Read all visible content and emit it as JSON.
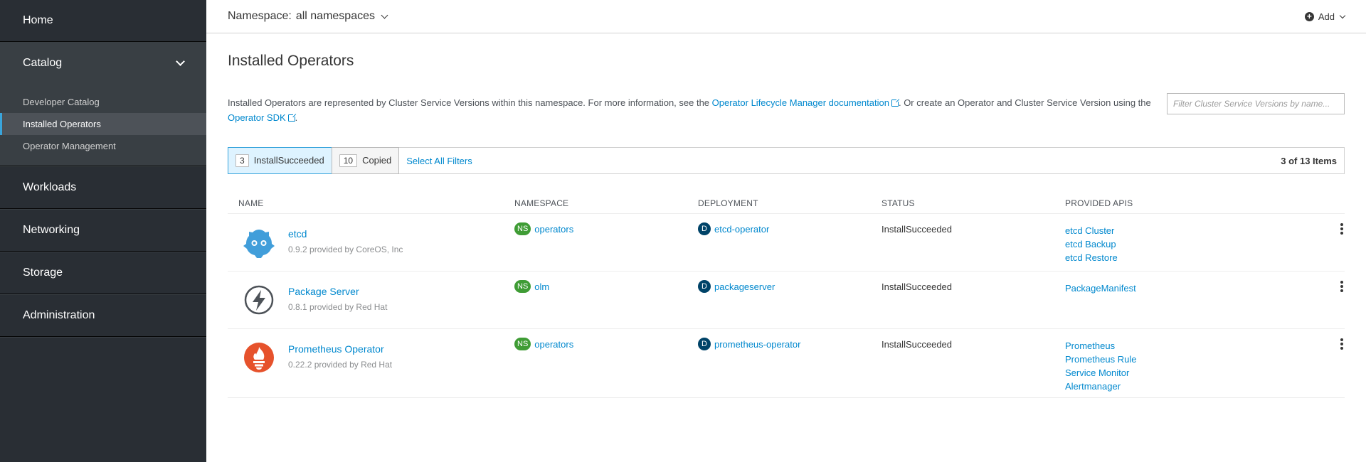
{
  "sidebar": {
    "home": "Home",
    "catalog": "Catalog",
    "catalog_items": [
      "Developer Catalog",
      "Installed Operators",
      "Operator Management"
    ],
    "workloads": "Workloads",
    "networking": "Networking",
    "storage": "Storage",
    "administration": "Administration"
  },
  "topbar": {
    "namespace_label": "Namespace:",
    "namespace_value": "all namespaces",
    "add_label": "Add"
  },
  "page": {
    "title": "Installed Operators",
    "desc_part1": "Installed Operators are represented by Cluster Service Versions within this namespace. For more information, see the ",
    "desc_link1": "Operator Lifecycle Manager documentation",
    "desc_part2": ". Or create an Operator and Cluster Service Version using the ",
    "desc_link2": "Operator SDK",
    "desc_part3": ".",
    "filter_placeholder": "Filter Cluster Service Versions by name..."
  },
  "filters": {
    "chip1_count": "3",
    "chip1_label": "InstallSucceeded",
    "chip2_count": "10",
    "chip2_label": "Copied",
    "select_all": "Select All Filters",
    "items_count": "3 of 13 Items"
  },
  "table": {
    "headers": {
      "name": "NAME",
      "namespace": "NAMESPACE",
      "deployment": "DEPLOYMENT",
      "status": "STATUS",
      "apis": "PROVIDED APIS"
    },
    "rows": [
      {
        "name": "etcd",
        "meta": "0.9.2 provided by CoreOS, Inc",
        "ns_badge": "NS",
        "namespace": "operators",
        "dep_badge": "D",
        "deployment": "etcd-operator",
        "status": "InstallSucceeded",
        "apis": [
          "etcd Cluster",
          "etcd Backup",
          "etcd Restore"
        ]
      },
      {
        "name": "Package Server",
        "meta": "0.8.1 provided by Red Hat",
        "ns_badge": "NS",
        "namespace": "olm",
        "dep_badge": "D",
        "deployment": "packageserver",
        "status": "InstallSucceeded",
        "apis": [
          "PackageManifest"
        ]
      },
      {
        "name": "Prometheus Operator",
        "meta": "0.22.2 provided by Red Hat",
        "ns_badge": "NS",
        "namespace": "operators",
        "dep_badge": "D",
        "deployment": "prometheus-operator",
        "status": "InstallSucceeded",
        "apis": [
          "Prometheus",
          "Prometheus Rule",
          "Service Monitor",
          "Alertmanager"
        ]
      }
    ]
  },
  "icons": {
    "etcd": "etcd-logo-icon",
    "package_server": "lightning-bolt-icon",
    "prometheus": "prometheus-flame-icon"
  },
  "colors": {
    "sidebar_bg": "#292e34",
    "link": "#0088ce",
    "active_accent": "#39a5dc",
    "ns_badge": "#3f9c35",
    "dep_badge": "#004368",
    "etcd_blue": "#419eda",
    "prometheus_red": "#e6522c"
  }
}
